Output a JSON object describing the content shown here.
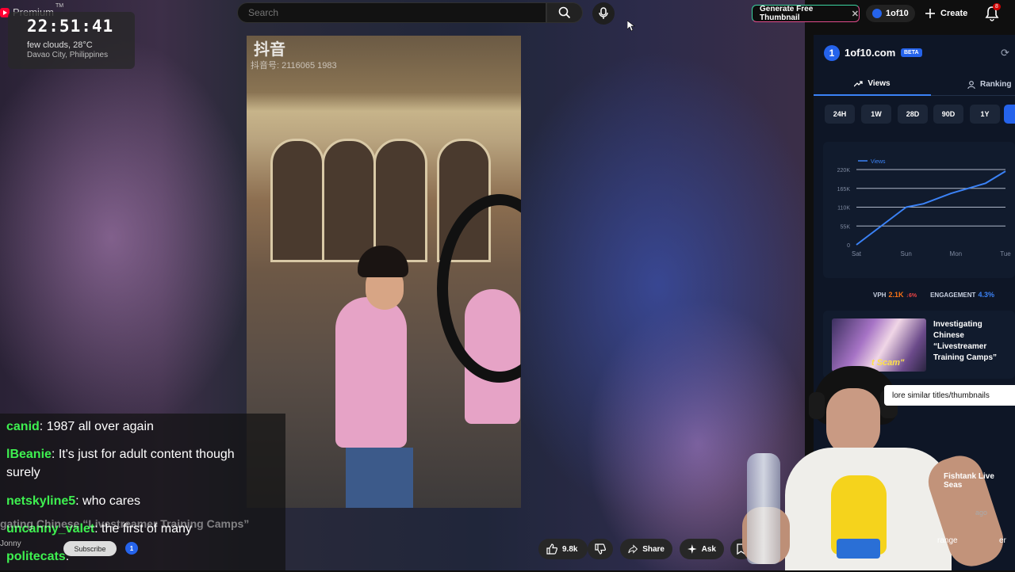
{
  "header": {
    "premium_label": "Premium",
    "premium_tm": "TM",
    "search_placeholder": "Search",
    "generate_thumbnail_label": "Generate Free Thumbnail",
    "oneof10_label": "1of10",
    "create_label": "Create",
    "notifications_count": "8"
  },
  "clock": {
    "time": "22:51:41",
    "weather": "few clouds, 28°C",
    "location": "Davao City, Philippines"
  },
  "video": {
    "watermark": "抖音",
    "watermark_id": "抖音号: 2116065 1983",
    "overlay_title": "gating Chinese “Livestreamer Training Camps”",
    "channel_name": "Jonny",
    "subscribe_label": "Subscribe",
    "channel_badge": "1",
    "actions": {
      "like_count": "9.8k",
      "share_label": "Share",
      "ask_label": "Ask"
    }
  },
  "chat": [
    {
      "user": "canid",
      "message": ": 1987 all over again"
    },
    {
      "user": "lBeanie",
      "message": ": It's just for adult content though surely"
    },
    {
      "user": "netskyline5",
      "message": ": who cares"
    },
    {
      "user": "uncanny_valet",
      "message": ": the first of many"
    },
    {
      "user": "politecats",
      "message": ":"
    }
  ],
  "extension": {
    "name": "1of10.com",
    "beta": "BETA",
    "logo_digit": "1",
    "tabs": {
      "views": "Views",
      "ranking": "Ranking"
    },
    "ranges": [
      "24H",
      "1W",
      "28D",
      "90D",
      "1Y"
    ],
    "stats": {
      "vph_label": "VPH",
      "vph_value": "2.1K",
      "vph_pct": "↓6%",
      "engagement_label": "ENGAGEMENT",
      "engagement_value": "4.3%"
    },
    "similar_title": "Investigating Chinese “Livestreamer Training Camps”",
    "similar_thumb_text": "t Scam\"",
    "explore_label": "lore similar titles/thumbnails",
    "recommend_1": "Fishtank Live Seas",
    "recommend_1_meta": "ago",
    "recommend_2": "range",
    "recommend_2b": "er"
  },
  "chart_data": {
    "type": "line",
    "title": "",
    "legend": [
      "Views"
    ],
    "categories": [
      "Sat",
      "Sun",
      "Mon",
      "Tue"
    ],
    "y_ticks": [
      "0",
      "55K",
      "110K",
      "165K",
      "220K"
    ],
    "ylim": [
      0,
      220000
    ],
    "grid": true,
    "legend_position": "top-left",
    "series": [
      {
        "name": "Views",
        "x": [
          0,
          0.5,
          1.0,
          1.35,
          1.9,
          2.6,
          3.0
        ],
        "values": [
          0,
          55000,
          110000,
          120000,
          150000,
          180000,
          215000
        ],
        "color": "#3b82f6"
      }
    ]
  },
  "colors": {
    "accent": "#3b82f6",
    "chat_username": "#3ef050",
    "youtube_red": "#ff0033"
  }
}
